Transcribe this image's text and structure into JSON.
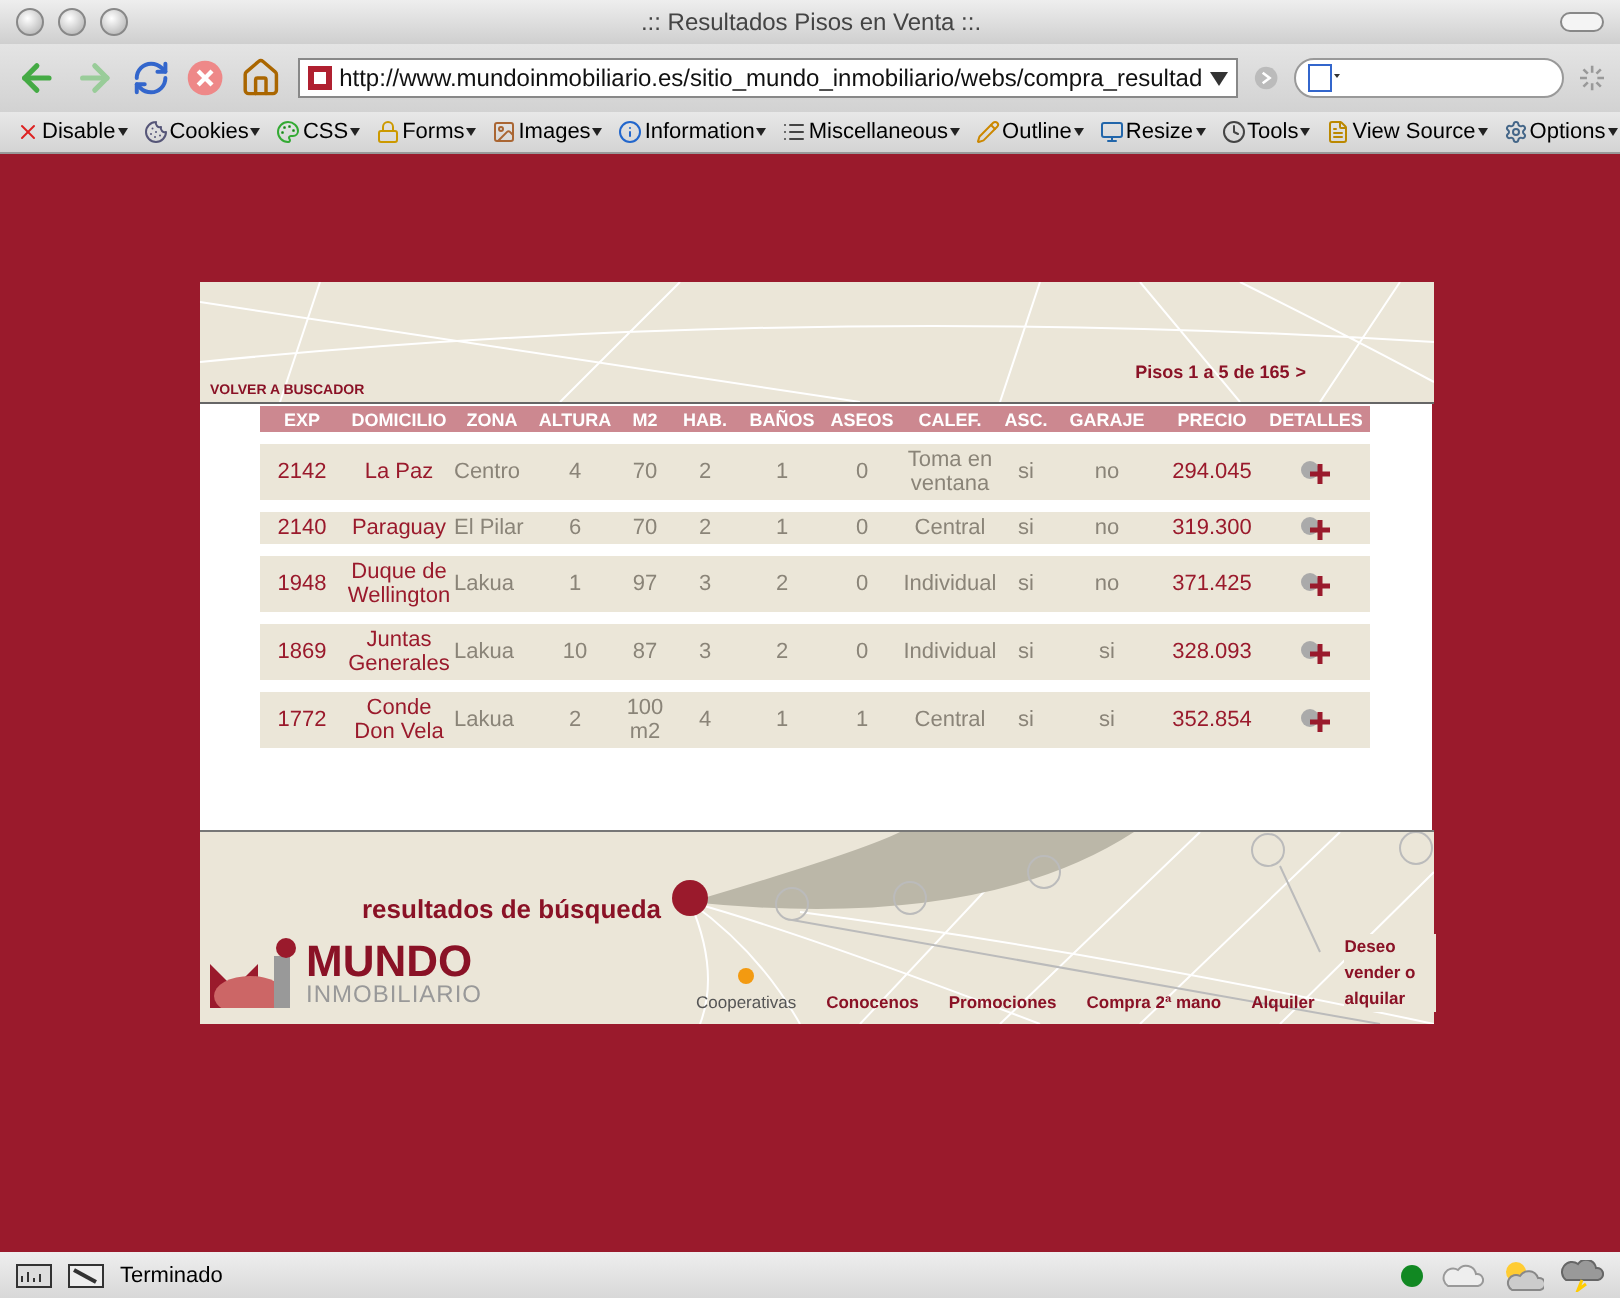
{
  "window": {
    "title": ".:: Resultados Pisos en Venta ::."
  },
  "address_bar": {
    "url": "http://www.mundoinmobiliario.es/sitio_mundo_inmobiliario/webs/compra_resultad"
  },
  "toolbar": [
    {
      "label": "Disable",
      "kind": "disable"
    },
    {
      "label": "Cookies",
      "kind": "cookies"
    },
    {
      "label": "CSS",
      "kind": "css"
    },
    {
      "label": "Forms",
      "kind": "forms"
    },
    {
      "label": "Images",
      "kind": "images"
    },
    {
      "label": "Information",
      "kind": "information"
    },
    {
      "label": "Miscellaneous",
      "kind": "misc"
    },
    {
      "label": "Outline",
      "kind": "outline"
    },
    {
      "label": "Resize",
      "kind": "resize"
    },
    {
      "label": "Tools",
      "kind": "tools"
    },
    {
      "label": "View Source",
      "kind": "source"
    },
    {
      "label": "Options",
      "kind": "options"
    }
  ],
  "page": {
    "back_link": "VOLVER A BUSCADOR",
    "pagination": "Pisos 1 a 5 de 165",
    "next": ">",
    "table": {
      "columns": [
        "EXP",
        "DOMICILIO",
        "ZONA",
        "ALTURA",
        "M2",
        "HAB.",
        "BAÑOS",
        "ASEOS",
        "CALEF.",
        "ASC.",
        "GARAJE",
        "PRECIO",
        "DETALLES"
      ],
      "rows": [
        [
          "2142",
          "La Paz",
          "Centro",
          "4",
          "70",
          "2",
          "1",
          "0",
          "Toma en ventana",
          "si",
          "no",
          "294.045"
        ],
        [
          "2140",
          "Paraguay",
          "El Pilar",
          "6",
          "70",
          "2",
          "1",
          "0",
          "Central",
          "si",
          "no",
          "319.300"
        ],
        [
          "1948",
          "Duque de Wellington",
          "Lakua",
          "1",
          "97",
          "3",
          "2",
          "0",
          "Individual",
          "si",
          "no",
          "371.425"
        ],
        [
          "1869",
          "Juntas Generales",
          "Lakua",
          "10",
          "87",
          "3",
          "2",
          "0",
          "Individual",
          "si",
          "si",
          "328.093"
        ],
        [
          "1772",
          "Conde Don Vela",
          "Lakua",
          "2",
          "100 m2",
          "4",
          "1",
          "1",
          "Central",
          "si",
          "si",
          "352.854"
        ]
      ]
    },
    "section_title": "resultados de búsqueda",
    "logo": {
      "name": "MUNDO",
      "tagline": "INMOBILIARIO"
    },
    "nav": [
      {
        "label": "Cooperativas",
        "selected": true
      },
      {
        "label": "Conocenos",
        "selected": false
      },
      {
        "label": "Promociones",
        "selected": false
      },
      {
        "label": "Compra 2ª mano",
        "selected": false
      },
      {
        "label": "Alquiler",
        "selected": false
      },
      {
        "label": "Deseo vender o alquilar",
        "selected": false
      }
    ]
  },
  "status_bar": {
    "text": "Terminado"
  }
}
